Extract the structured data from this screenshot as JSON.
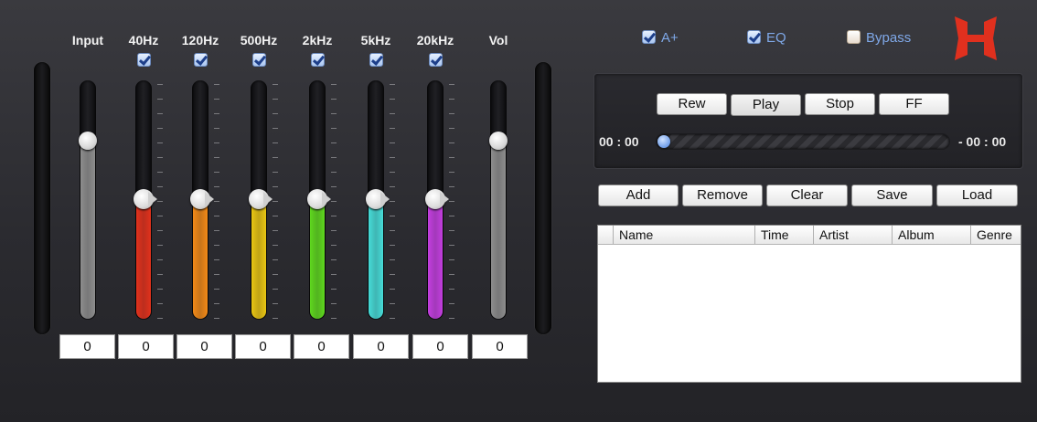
{
  "equalizer": {
    "channels": [
      {
        "label": "Input",
        "value": "0",
        "has_toggle": false,
        "level": 0.75,
        "color": "#8e8e8e",
        "knob": "round"
      },
      {
        "label": "40Hz",
        "value": "0",
        "has_toggle": true,
        "level": 0.5,
        "color": "#e3321d",
        "knob": "eq"
      },
      {
        "label": "120Hz",
        "value": "0",
        "has_toggle": true,
        "level": 0.5,
        "color": "#f28a18",
        "knob": "eq"
      },
      {
        "label": "500Hz",
        "value": "0",
        "has_toggle": true,
        "level": 0.5,
        "color": "#e9c613",
        "knob": "eq"
      },
      {
        "label": "2kHz",
        "value": "0",
        "has_toggle": true,
        "level": 0.5,
        "color": "#5fd81f",
        "knob": "eq"
      },
      {
        "label": "5kHz",
        "value": "0",
        "has_toggle": true,
        "level": 0.5,
        "color": "#47dcd8",
        "knob": "eq"
      },
      {
        "label": "20kHz",
        "value": "0",
        "has_toggle": true,
        "level": 0.5,
        "color": "#c43fe0",
        "knob": "eq"
      },
      {
        "label": "Vol",
        "value": "0",
        "has_toggle": false,
        "level": 0.75,
        "color": "#8e8e8e",
        "knob": "round"
      }
    ]
  },
  "toggles": {
    "a_plus": {
      "label": "A+",
      "checked": true
    },
    "eq": {
      "label": "EQ",
      "checked": true
    },
    "bypass": {
      "label": "Bypass",
      "checked": false
    }
  },
  "transport": {
    "rew": "Rew",
    "play": "Play",
    "stop": "Stop",
    "ff": "FF",
    "time_elapsed": "00 : 00",
    "time_remaining": "- 00 : 00",
    "progress": 0.0
  },
  "playlist_controls": {
    "add": "Add",
    "remove": "Remove",
    "clear": "Clear",
    "save": "Save",
    "load": "Load"
  },
  "playlist": {
    "columns": [
      "Name",
      "Time",
      "Artist",
      "Album",
      "Genre"
    ],
    "rows": []
  },
  "colors": {
    "accent_text": "#7fa8e8",
    "logo_red": "#e0301e"
  }
}
